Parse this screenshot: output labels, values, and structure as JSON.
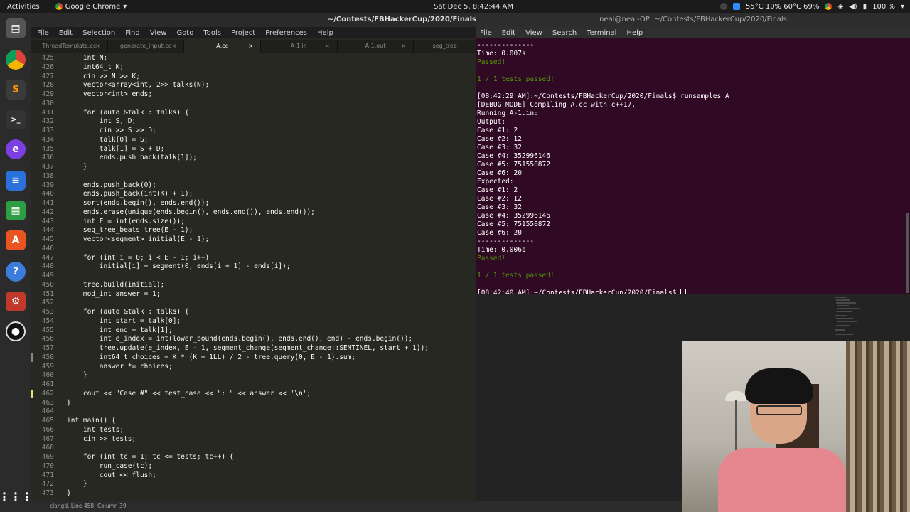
{
  "topbar": {
    "activities": "Activities",
    "app_name": "Google Chrome",
    "clock": "Sat Dec  5,  8:42:44 AM",
    "sysinfo": "55°C 10% 60°C 69%",
    "battery": "100 %"
  },
  "sublime": {
    "title": "~/Contests/FBHackerCup/2020/Finals",
    "menu": [
      "File",
      "Edit",
      "Selection",
      "Find",
      "View",
      "Goto",
      "Tools",
      "Project",
      "Preferences",
      "Help"
    ],
    "tabs": [
      "ThreadTemplate.cc",
      "generate_input.cc",
      "A.cc",
      "A-1.in",
      "A-1.out",
      "seg_tree"
    ],
    "active_tab": 2,
    "line_numbers": [
      "425",
      "426",
      "427",
      "428",
      "429",
      "430",
      "431",
      "432",
      "433",
      "434",
      "435",
      "436",
      "437",
      "438",
      "439",
      "440",
      "441",
      "442",
      "443",
      "444",
      "445",
      "446",
      "447",
      "448",
      "449",
      "450",
      "451",
      "452",
      "453",
      "454",
      "455",
      "456",
      "457",
      "458",
      "459",
      "460",
      "461",
      "462",
      "463",
      "464",
      "465",
      "466",
      "467",
      "468",
      "469",
      "470",
      "471",
      "472",
      "473"
    ],
    "code_lines": [
      "    int N;",
      "    int64_t K;",
      "    cin >> N >> K;",
      "    vector<array<int, 2>> talks(N);",
      "    vector<int> ends;",
      "",
      "    for (auto &talk : talks) {",
      "        int S, D;",
      "        cin >> S >> D;",
      "        talk[0] = S;",
      "        talk[1] = S + D;",
      "        ends.push_back(talk[1]);",
      "    }",
      "",
      "    ends.push_back(0);",
      "    ends.push_back(int(K) + 1);",
      "    sort(ends.begin(), ends.end());",
      "    ends.erase(unique(ends.begin(), ends.end()), ends.end());",
      "    int E = int(ends.size());",
      "    seg_tree_beats tree(E - 1);",
      "    vector<segment> initial(E - 1);",
      "",
      "    for (int i = 0; i < E - 1; i++)",
      "        initial[i] = segment(0, ends[i + 1] - ends[i]);",
      "",
      "    tree.build(initial);",
      "    mod_int answer = 1;",
      "",
      "    for (auto &talk : talks) {",
      "        int start = talk[0];",
      "        int end = talk[1];",
      "        int e_index = int(lower_bound(ends.begin(), ends.end(), end) - ends.begin());",
      "        tree.update(e_index, E - 1, segment_change(segment_change::SENTINEL, start + 1));",
      "        int64_t choices = K * (K + 1LL) / 2 - tree.query(0, E - 1).sum;",
      "        answer *= choices;",
      "    }",
      "",
      "    cout << \"Case #\" << test_case << \": \" << answer << '\\n';",
      "}",
      "",
      "int main() {",
      "    int tests;",
      "    cin >> tests;",
      "",
      "    for (int tc = 1; tc <= tests; tc++) {",
      "        run_case(tc);",
      "        cout << flush;",
      "    }",
      "}"
    ],
    "status": "clangd, Line 458, Column 39"
  },
  "terminal": {
    "title": "neal@neal-OP: ~/Contests/FBHackerCup/2020/Finals",
    "menu": [
      "File",
      "Edit",
      "View",
      "Search",
      "Terminal",
      "Help"
    ],
    "lines": [
      {
        "t": "--------------",
        "c": "w"
      },
      {
        "t": "Time: 0.007s",
        "c": "w"
      },
      {
        "t": "Passed!",
        "c": "g"
      },
      {
        "t": "",
        "c": "w"
      },
      {
        "t": "1 / 1 tests passed!",
        "c": "g"
      },
      {
        "t": "",
        "c": "w"
      },
      {
        "t": "[08:42:29 AM]:~/Contests/FBHackerCup/2020/Finals$ runsamples A",
        "c": "w"
      },
      {
        "t": "[DEBUG MODE] Compiling A.cc with c++17.",
        "c": "w"
      },
      {
        "t": "Running A-1.in:",
        "c": "w"
      },
      {
        "t": "Output:",
        "c": "w"
      },
      {
        "t": "Case #1: 2",
        "c": "w"
      },
      {
        "t": "Case #2: 12",
        "c": "w"
      },
      {
        "t": "Case #3: 32",
        "c": "w"
      },
      {
        "t": "Case #4: 352996146",
        "c": "w"
      },
      {
        "t": "Case #5: 751550872",
        "c": "w"
      },
      {
        "t": "Case #6: 20",
        "c": "w"
      },
      {
        "t": "Expected:",
        "c": "w"
      },
      {
        "t": "Case #1: 2",
        "c": "w"
      },
      {
        "t": "Case #2: 12",
        "c": "w"
      },
      {
        "t": "Case #3: 32",
        "c": "w"
      },
      {
        "t": "Case #4: 352996146",
        "c": "w"
      },
      {
        "t": "Case #5: 751550872",
        "c": "w"
      },
      {
        "t": "Case #6: 20",
        "c": "w"
      },
      {
        "t": "--------------",
        "c": "w"
      },
      {
        "t": "Time: 0.006s",
        "c": "w"
      },
      {
        "t": "Passed!",
        "c": "g"
      },
      {
        "t": "",
        "c": "w"
      },
      {
        "t": "1 / 1 tests passed!",
        "c": "g"
      },
      {
        "t": "",
        "c": "w"
      },
      {
        "t": "[08:42:40 AM]:~/Contests/FBHackerCup/2020/Finals$ ",
        "c": "w"
      }
    ]
  }
}
